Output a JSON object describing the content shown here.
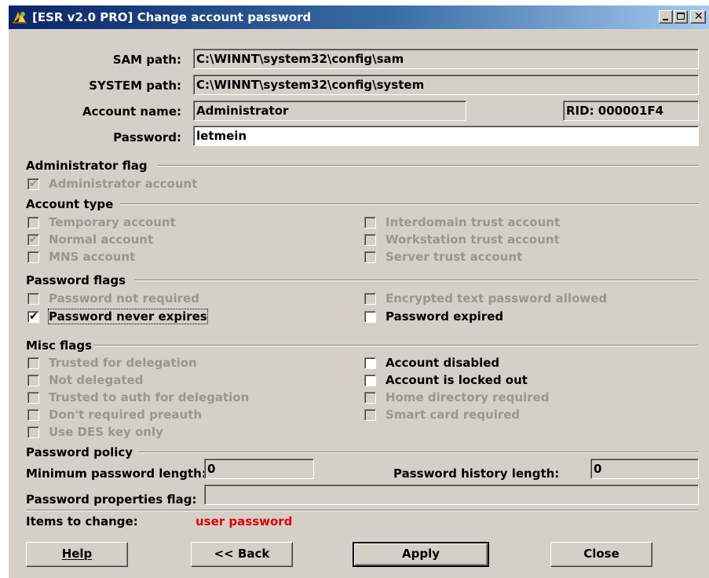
{
  "window": {
    "title": "[ESR v2.0 PRO] Change account password",
    "app_icon": "esr-app-icon",
    "controls": [
      "minimize-icon",
      "maximize-icon",
      "close-icon"
    ]
  },
  "fields": {
    "sam_label": "SAM path:",
    "sam_value": "C:\\WINNT\\system32\\config\\sam",
    "system_label": "SYSTEM path:",
    "system_value": "C:\\WINNT\\system32\\config\\system",
    "account_label": "Account name:",
    "account_value": "Administrator",
    "rid_value": "RID: 000001F4",
    "password_label": "Password:",
    "password_value": "letmein"
  },
  "admin_flag": {
    "title": "Administrator flag",
    "items": [
      {
        "label": "Administrator account",
        "checked": true,
        "enabled": false
      }
    ]
  },
  "account_type": {
    "title": "Account type",
    "left": [
      {
        "label": "Temporary account",
        "checked": false,
        "enabled": false
      },
      {
        "label": "Normal account",
        "checked": true,
        "enabled": false
      },
      {
        "label": "MNS account",
        "checked": false,
        "enabled": false
      }
    ],
    "right": [
      {
        "label": "Interdomain trust account",
        "checked": false,
        "enabled": false
      },
      {
        "label": "Workstation trust account",
        "checked": false,
        "enabled": false
      },
      {
        "label": "Server trust account",
        "checked": false,
        "enabled": false
      }
    ]
  },
  "password_flags": {
    "title": "Password flags",
    "left": [
      {
        "label": "Password not required",
        "checked": false,
        "enabled": false
      },
      {
        "label": "Password never expires",
        "checked": true,
        "enabled": true
      }
    ],
    "right": [
      {
        "label": "Encrypted text password allowed",
        "checked": false,
        "enabled": false
      },
      {
        "label": "Password expired",
        "checked": false,
        "enabled": true
      }
    ]
  },
  "misc_flags": {
    "title": "Misc flags",
    "left": [
      {
        "label": "Trusted for delegation",
        "checked": false,
        "enabled": false
      },
      {
        "label": "Not delegated",
        "checked": false,
        "enabled": false
      },
      {
        "label": "Trusted to auth for delegation",
        "checked": false,
        "enabled": false
      },
      {
        "label": "Don't required preauth",
        "checked": false,
        "enabled": false
      },
      {
        "label": "Use DES key only",
        "checked": false,
        "enabled": false
      }
    ],
    "right": [
      {
        "label": "Account disabled",
        "checked": false,
        "enabled": true
      },
      {
        "label": "Account is locked out",
        "checked": false,
        "enabled": true
      },
      {
        "label": "Home directory required",
        "checked": false,
        "enabled": false
      },
      {
        "label": "Smart card required",
        "checked": false,
        "enabled": false
      }
    ]
  },
  "policy": {
    "title": "Password policy",
    "min_length_label": "Minimum password length:",
    "min_length_value": "0",
    "history_label": "Password history length:",
    "history_value": "0",
    "props_label": "Password properties flag:",
    "props_value": ""
  },
  "status": {
    "label": "Items to change:",
    "value": "user password",
    "value_color": "#e00000"
  },
  "buttons": {
    "help_label": "Help",
    "back_label": "<< Back",
    "apply_label": "Apply",
    "close_label": "Close"
  }
}
